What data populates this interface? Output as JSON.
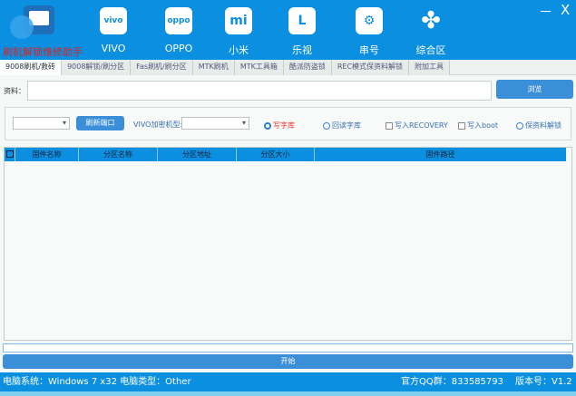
{
  "header": {
    "logo_text": "刷机解锁维修助手",
    "nav": [
      {
        "label": "VIVO",
        "icon": "vivo-icon",
        "glyph": "vivo"
      },
      {
        "label": "OPPO",
        "icon": "oppo-icon",
        "glyph": "oppo"
      },
      {
        "label": "小米",
        "icon": "xiaomi-icon",
        "glyph": "mi"
      },
      {
        "label": "乐视",
        "icon": "letv-icon",
        "glyph": "L"
      },
      {
        "label": "串号",
        "icon": "gear-icon",
        "glyph": "⚙"
      },
      {
        "label": "综合区",
        "icon": "clover-icon",
        "glyph": "✤"
      }
    ],
    "minimize": "－",
    "close": "X"
  },
  "tabs": [
    "9008刷机/救砖",
    "9008解锁/刷分区",
    "Fas刷机/刷分区",
    "MTK刷机",
    "MTK工具箱",
    "酷派防盗锁",
    "REC模式保资料解锁",
    "附加工具"
  ],
  "file": {
    "label": "资料：",
    "value": "",
    "browse": "浏览"
  },
  "options": {
    "port_select": "",
    "refresh_port": "刷新端口",
    "vivo_model_label": "VIVO加密机型:",
    "vivo_model_select": "",
    "radio_write": "写字库",
    "radio_read": "回读字库",
    "check_recovery": "写入RECOVERY",
    "check_boot": "写入boot",
    "radio_keep": "保资料解锁"
  },
  "table": {
    "columns": [
      "",
      "固件名称",
      "分区名称",
      "分区地址",
      "分区大小",
      "固件路径"
    ],
    "rows": []
  },
  "progress": 0,
  "start": "开始",
  "status": {
    "system": "电脑系统：Windows 7 x32 电脑类型：Other",
    "qq": "官方QQ群：833585793",
    "version": "版本号：V1.2"
  },
  "colors": {
    "accent": "#0b8fe0",
    "button": "#3b8fd9",
    "selected_radio": "#e33"
  }
}
